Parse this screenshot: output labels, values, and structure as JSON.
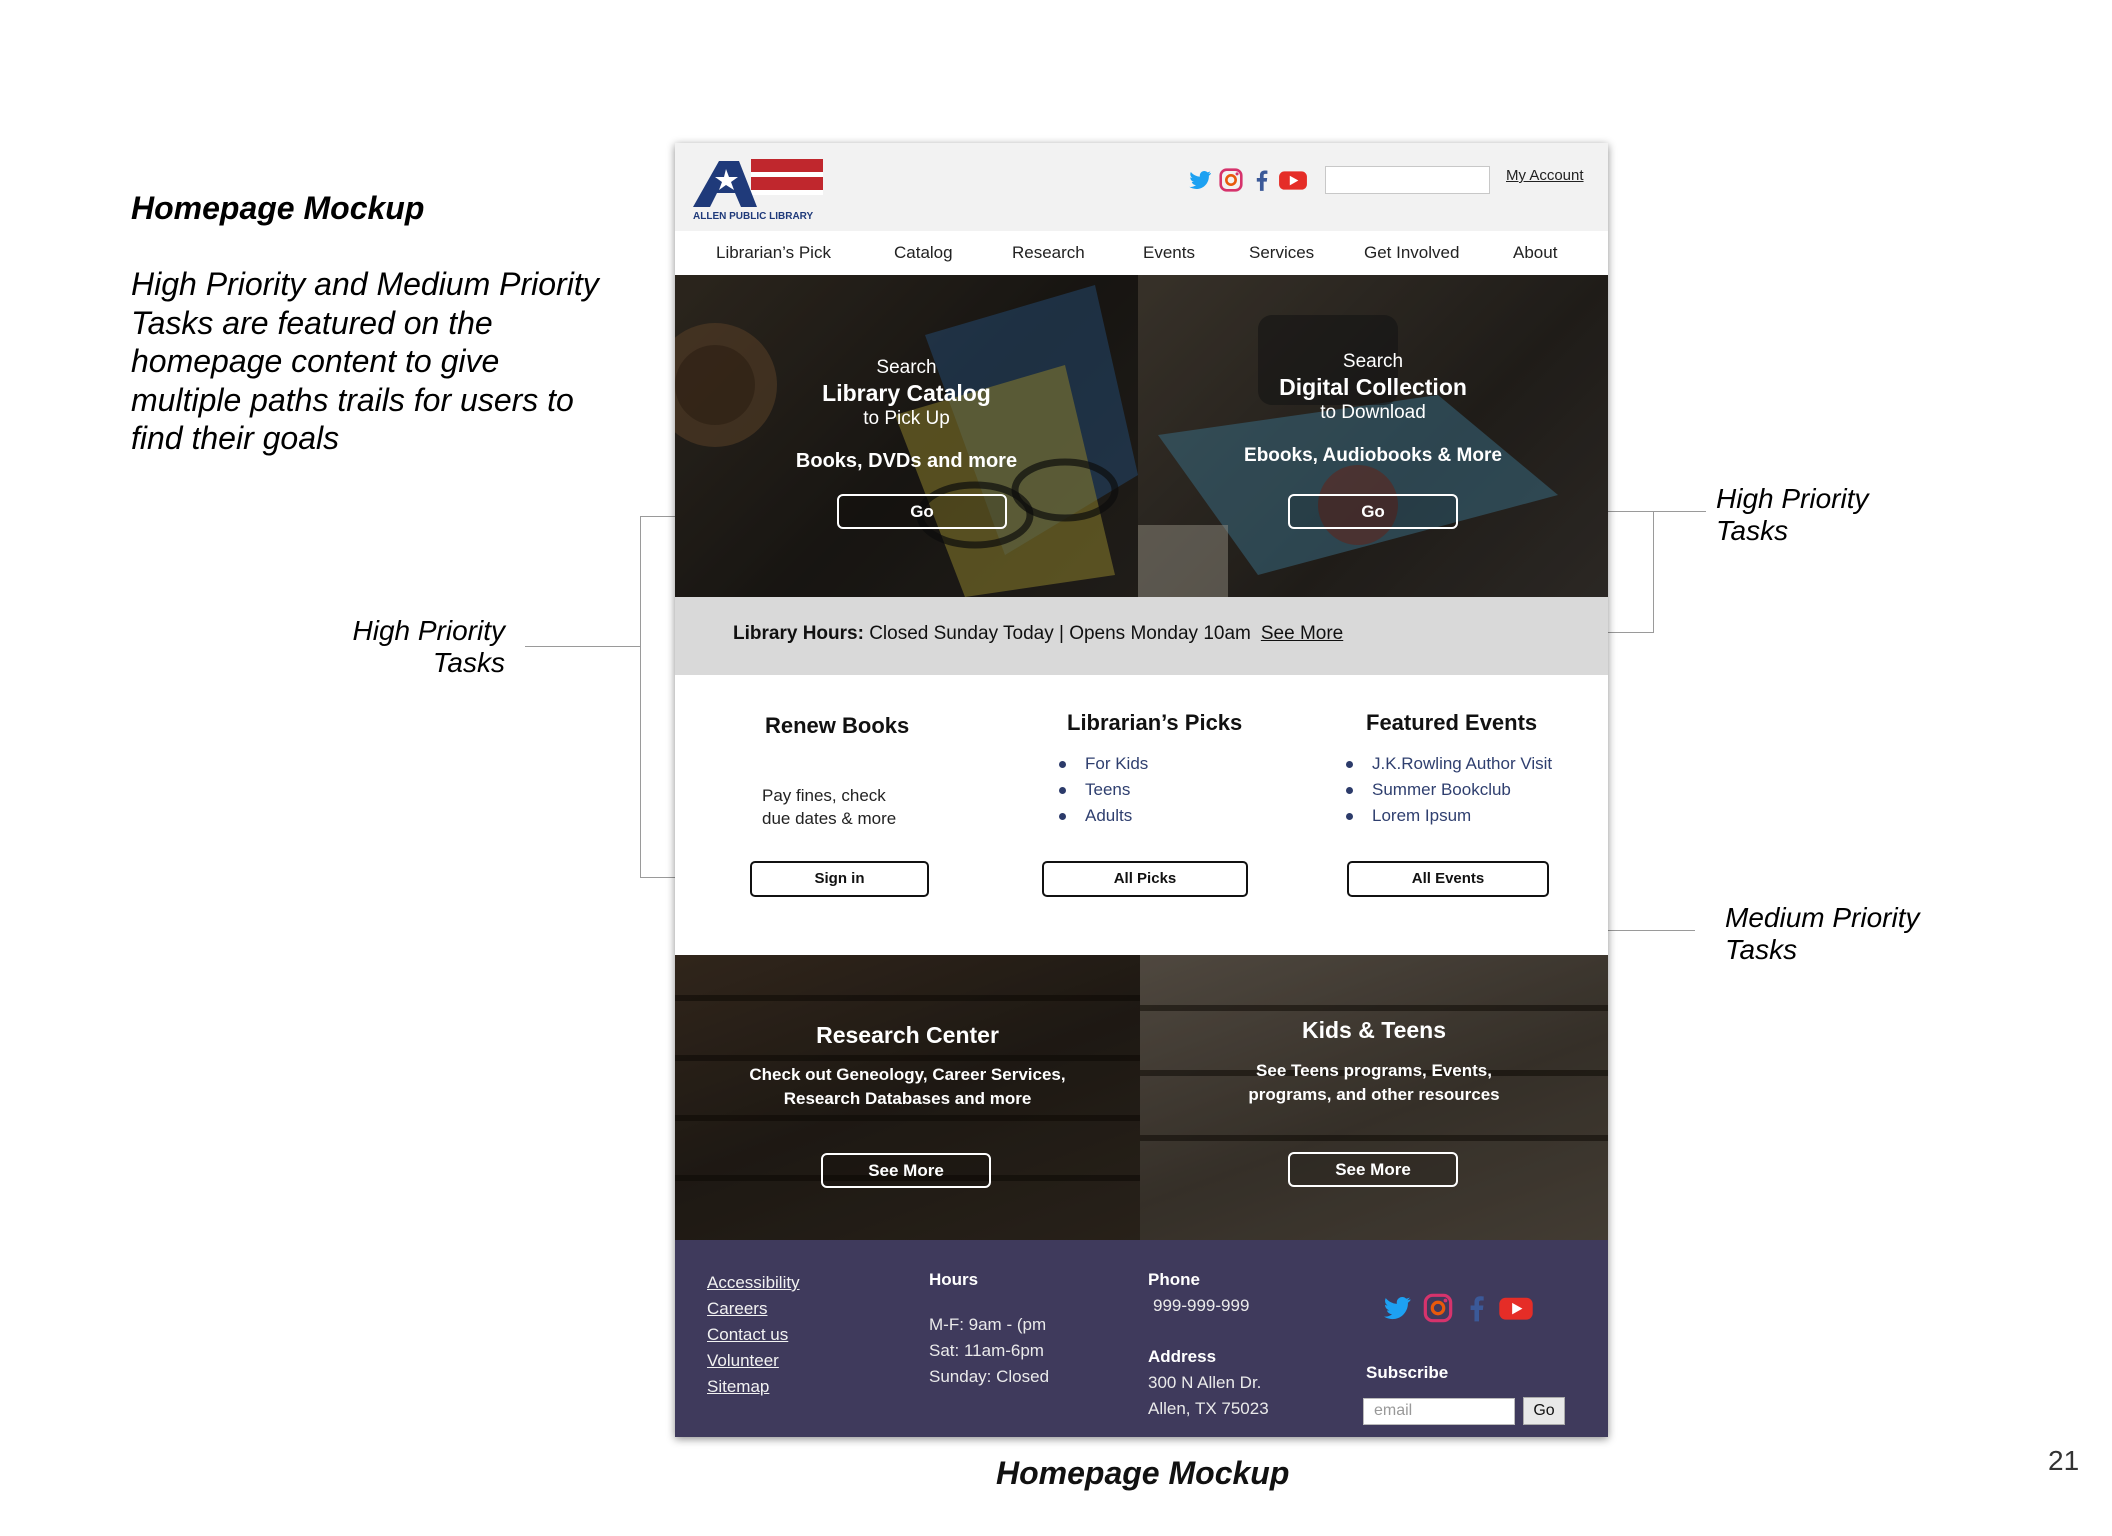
{
  "slide": {
    "title": "Homepage Mockup",
    "description": "High Priority and Medium Priority Tasks are featured on the homepage content to give multiple paths trails for users to find their goals",
    "annotation_left": "High Priority Tasks",
    "annotation_right": "High Priority Tasks",
    "annotation_medium": "Medium Priority Tasks",
    "caption": "Homepage Mockup",
    "page_number": "21"
  },
  "header": {
    "logo_text": "ALLEN PUBLIC LIBRARY",
    "my_account": "My Account",
    "search_placeholder": ""
  },
  "nav": {
    "items": [
      "Librarian’s Pick",
      "Catalog",
      "Research",
      "Events",
      "Services",
      "Get Involved",
      "About"
    ]
  },
  "hero": {
    "left": {
      "line1": "Search",
      "line2": "Library Catalog",
      "line3": "to Pick Up",
      "line4": "Books, DVDs and more",
      "button": "Go"
    },
    "right": {
      "line1": "Search",
      "line2": "Digital Collection",
      "line3": "to Download",
      "line4": "Ebooks, Audiobooks & More",
      "button": "Go"
    }
  },
  "hours": {
    "label": "Library Hours:",
    "text": "Closed Sunday Today | Opens Monday 10am",
    "link": "See More"
  },
  "columns": {
    "renew": {
      "title": "Renew Books",
      "line1": "Pay fines, check",
      "line2": "due dates & more",
      "button": "Sign in"
    },
    "picks": {
      "title": "Librarian’s Picks",
      "items": [
        "For Kids",
        "Teens",
        "Adults"
      ],
      "button": "All Picks"
    },
    "events": {
      "title": "Featured Events",
      "items": [
        "J.K.Rowling Author Visit",
        "Summer Bookclub",
        "Lorem Ipsum"
      ],
      "button": "All Events"
    }
  },
  "promos": {
    "research": {
      "title": "Research Center",
      "line1": "Check out Geneology, Career Services,",
      "line2": "Research Databases and more",
      "button": "See More"
    },
    "kids": {
      "title": "Kids & Teens",
      "line1": "See Teens  programs, Events,",
      "line2": "programs, and other resources",
      "button": "See More"
    }
  },
  "footer": {
    "links": [
      "Accessibility",
      "Careers",
      "Contact us",
      "Volunteer",
      "Sitemap"
    ],
    "hours_title": "Hours",
    "hours_lines": [
      "M-F: 9am - (pm",
      "Sat: 11am-6pm",
      "Sunday: Closed"
    ],
    "phone_title": "Phone",
    "phone": "999-999-999",
    "address_title": "Address",
    "address_lines": [
      "300 N Allen Dr.",
      "Allen, TX 75023"
    ],
    "subscribe_title": "Subscribe",
    "email_placeholder": "email",
    "go": "Go"
  },
  "colors": {
    "footer_bg": "#3f3a5c",
    "link_blue": "#2f3f6f",
    "logo_blue": "#1f3a7a",
    "logo_red": "#c0272d",
    "twitter": "#1da1f2",
    "facebook": "#3b5998",
    "youtube": "#e52d27"
  },
  "icons": [
    "twitter-icon",
    "instagram-icon",
    "facebook-icon",
    "youtube-icon"
  ]
}
